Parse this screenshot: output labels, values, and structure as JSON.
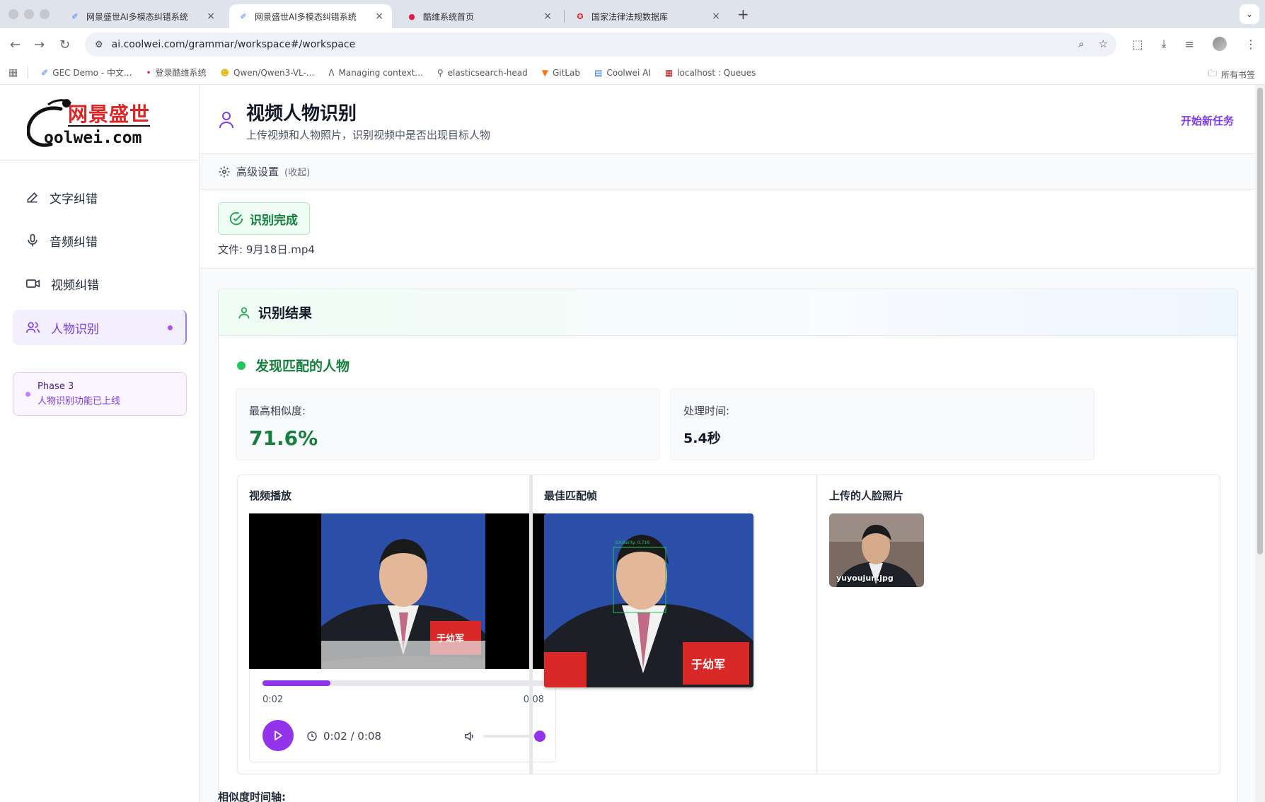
{
  "browser": {
    "tabs": [
      {
        "title": "网景盛世AI多模态纠错系统",
        "active": false
      },
      {
        "title": "网景盛世AI多模态纠错系统",
        "active": true
      },
      {
        "title": "酷维系统首页",
        "active": false
      },
      {
        "title": "国家法律法规数据库",
        "active": false
      }
    ],
    "url": "ai.coolwei.com/grammar/workspace#/workspace",
    "bookmarks": [
      "GEC Demo - 中文...",
      "登录酷维系统",
      "Qwen/Qwen3-VL-...",
      "Managing context...",
      "elasticsearch-head",
      "GitLab",
      "Coolwei AI",
      "localhost : Queues"
    ],
    "all_bookmarks": "所有书签"
  },
  "logo": {
    "cn": "网景盛世",
    "en": "oolwei.com"
  },
  "sidebar": {
    "items": [
      {
        "label": "文字纠错",
        "icon": "pencil-icon"
      },
      {
        "label": "音频纠错",
        "icon": "mic-icon"
      },
      {
        "label": "视频纠错",
        "icon": "video-icon"
      },
      {
        "label": "人物识别",
        "icon": "users-icon",
        "active": true
      }
    ],
    "phase": {
      "title": "Phase 3",
      "desc": "人物识别功能已上线"
    }
  },
  "header": {
    "title": "视频人物识别",
    "subtitle": "上传视频和人物照片，识别视频中是否出现目标人物",
    "new_task": "开始新任务"
  },
  "advanced": {
    "label": "高级设置",
    "state": "(收起)"
  },
  "status": {
    "badge": "识别完成",
    "file": "文件: 9月18日.mp4"
  },
  "result": {
    "title": "识别结果",
    "match": "发现匹配的人物",
    "max_similarity_label": "最高相似度:",
    "max_similarity": "71.6%",
    "time_label": "处理时间:",
    "time": "5.4秒",
    "panels": {
      "video_title": "视频播放",
      "frame_title": "最佳匹配帧",
      "face_title": "上传的人脸照片"
    },
    "player": {
      "current": "0:02",
      "duration": "0:08",
      "display": "0:02 / 0:08",
      "progress": 0.24,
      "volume": 1.0
    },
    "frame_caption": "Similarity: 0.716",
    "nameplate": "于幼军",
    "face_file": "yuyoujun.jpg",
    "timeline_label": "相似度时间轴:"
  },
  "colors": {
    "accent": "#9333ea",
    "success": "#15803d"
  }
}
